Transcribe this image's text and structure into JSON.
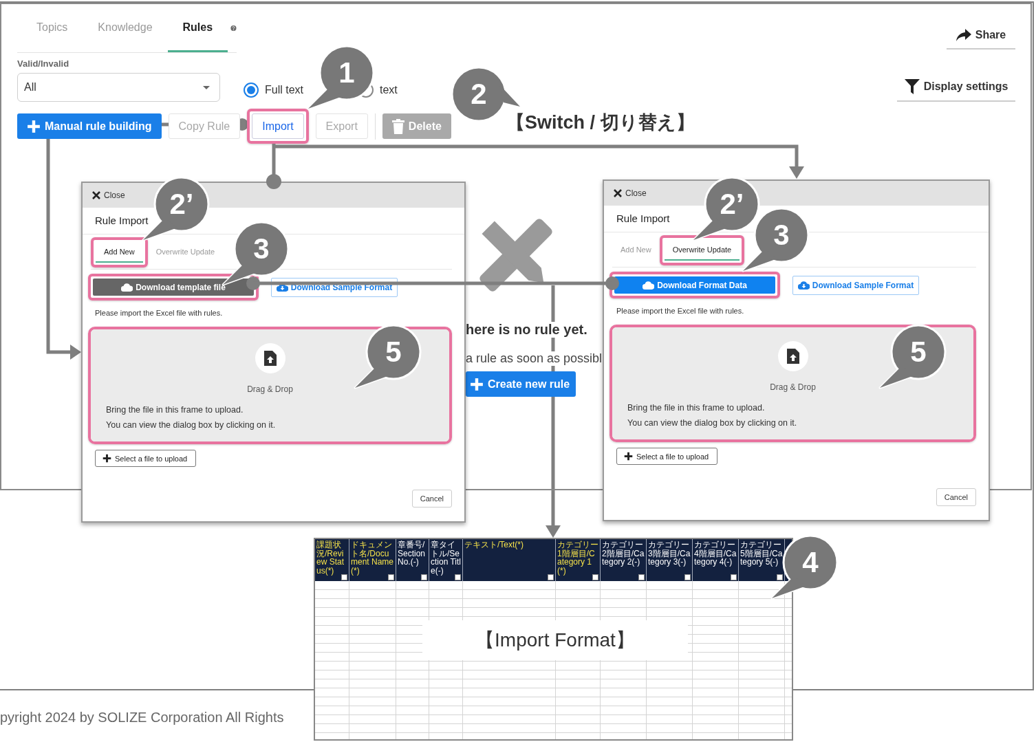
{
  "page": {
    "tabs": [
      {
        "label": "Topics",
        "selected": false
      },
      {
        "label": "Knowledge",
        "selected": false
      },
      {
        "label": "Rules",
        "selected": true
      }
    ],
    "share_button": "Share",
    "filter": {
      "label": "Valid/Invalid",
      "value": "All"
    },
    "search_mode": [
      {
        "label": "Full text",
        "selected": true
      },
      {
        "label": "text",
        "selected": false
      }
    ],
    "display_settings": "Display settings",
    "toolbar": [
      {
        "label": "Manual rule building",
        "kind": "primary",
        "disabled": false,
        "highlighted": false
      },
      {
        "label": "Copy Rule",
        "kind": "outline",
        "disabled": true,
        "highlighted": false
      },
      {
        "label": "Import",
        "kind": "outline",
        "disabled": false,
        "highlighted": true
      },
      {
        "label": "Export",
        "kind": "outline",
        "disabled": true,
        "highlighted": false
      },
      {
        "label": "Delete",
        "kind": "delete",
        "disabled": true,
        "highlighted": false
      }
    ],
    "empty_state": {
      "title": "here is no rule yet.",
      "message": "a rule as soon as possibl",
      "button": "Create new rule"
    },
    "footer": "pyright 2024 by SOLIZE Corporation All Rights"
  },
  "dialogs": [
    {
      "close_label": "Close",
      "title": "Rule Import",
      "tabs": [
        {
          "label": "Add New",
          "selected": true,
          "highlighted": true
        },
        {
          "label": "Overwrite Update",
          "selected": false,
          "highlighted": false
        }
      ],
      "primary_button": {
        "label": "Download template file",
        "kind": "dark",
        "highlighted": true
      },
      "secondary_button": "Download Sample Format",
      "note": "Please import the Excel file with rules.",
      "drop_zone": {
        "title": "Drag & Drop",
        "lines": [
          "Bring the file in this frame to upload.",
          "You can view the dialog box by clicking on it."
        ],
        "highlighted": true
      },
      "upload_button": "Select a file to upload",
      "cancel_button": "Cancel"
    },
    {
      "close_label": "Close",
      "title": "Rule Import",
      "tabs": [
        {
          "label": "Add New",
          "selected": false,
          "highlighted": false
        },
        {
          "label": "Overwrite Update",
          "selected": true,
          "highlighted": true
        }
      ],
      "primary_button": {
        "label": "Download Format Data",
        "kind": "blue",
        "highlighted": true
      },
      "secondary_button": "Download Sample Format",
      "note": "Please import the Excel file with rules.",
      "drop_zone": {
        "title": "Drag & Drop",
        "lines": [
          "Bring the file in this frame to upload.",
          "You can view the dialog box by clicking on it."
        ],
        "highlighted": true
      },
      "upload_button": "Select a file to upload",
      "cancel_button": "Cancel"
    }
  ],
  "spreadsheet": {
    "columns": [
      {
        "label": "課題状況/Review Status(*)",
        "required": true
      },
      {
        "label": "ドキュメント名/Document Name(*)",
        "required": true
      },
      {
        "label": "章番号/Section No.(-)",
        "required": false
      },
      {
        "label": "章タイトル/Section Title(-)",
        "required": false
      },
      {
        "label": "テキスト/Text(*)",
        "required": true
      },
      {
        "label": "カテゴリー1階層目/Category 1(*)",
        "required": true
      },
      {
        "label": "カテゴリー2階層目/Category 2(-)",
        "required": false
      },
      {
        "label": "カテゴリー3階層目/Category 3(-)",
        "required": false
      },
      {
        "label": "カテゴリー4階層目/Category 4(-)",
        "required": false
      },
      {
        "label": "カテゴリー5階層目/Category 5(-)",
        "required": false
      }
    ],
    "caption": "【Import Format】"
  },
  "annotations": {
    "switch_label": "【Switch / 切り替え】",
    "callouts": [
      {
        "label": "1"
      },
      {
        "label": "2"
      },
      {
        "label": "2’"
      },
      {
        "label": "3"
      },
      {
        "label": "5"
      },
      {
        "label": "2’"
      },
      {
        "label": "3"
      },
      {
        "label": "5"
      },
      {
        "label": "4"
      }
    ]
  }
}
